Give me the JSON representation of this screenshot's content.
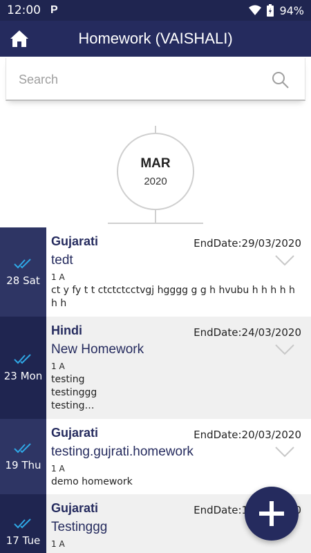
{
  "status_bar": {
    "time": "12:00",
    "app_badge": "P",
    "battery": "94%",
    "icons": [
      "wifi-icon",
      "battery-icon"
    ]
  },
  "app_bar": {
    "title": "Homework (VAISHALI)",
    "home_icon": "home-icon"
  },
  "search": {
    "placeholder": "Search",
    "value": ""
  },
  "month_header": {
    "month": "MAR",
    "year": "2020"
  },
  "homework": [
    {
      "date_label": "28 Sat",
      "subject": "Gujarati",
      "end_date": "EndDate:29/03/2020",
      "title": "tedt",
      "class": "1 A",
      "description": "ct y fy t t ctctctcctvgj hgggg g g h hvubu h h h h h h h",
      "date_bg": "#2e3564",
      "row_bg": "#ffffff"
    },
    {
      "date_label": "23 Mon",
      "subject": "Hindi",
      "end_date": "EndDate:24/03/2020",
      "title": "New Homework",
      "class": "1 A",
      "description": "testing\ntestinggg\ntesting…",
      "date_bg": "#1f2550",
      "row_bg": "#f0f0f0"
    },
    {
      "date_label": "19 Thu",
      "subject": "Gujarati",
      "end_date": "EndDate:20/03/2020",
      "title": "testing.gujrati.homework",
      "class": "1 A",
      "description": "demo homework",
      "date_bg": "#2e3564",
      "row_bg": "#ffffff"
    },
    {
      "date_label": "17 Tue",
      "subject": "Gujarati",
      "end_date": "EndDate:18/03/2020",
      "title": "Testinggg",
      "class": "1 A",
      "description": "",
      "date_bg": "#1f2550",
      "row_bg": "#f0f0f0"
    }
  ],
  "colors": {
    "primary": "#252b5e",
    "status_bar": "#1f2550",
    "check": "#2fa8e6"
  },
  "fab": {
    "icon": "plus-icon"
  }
}
